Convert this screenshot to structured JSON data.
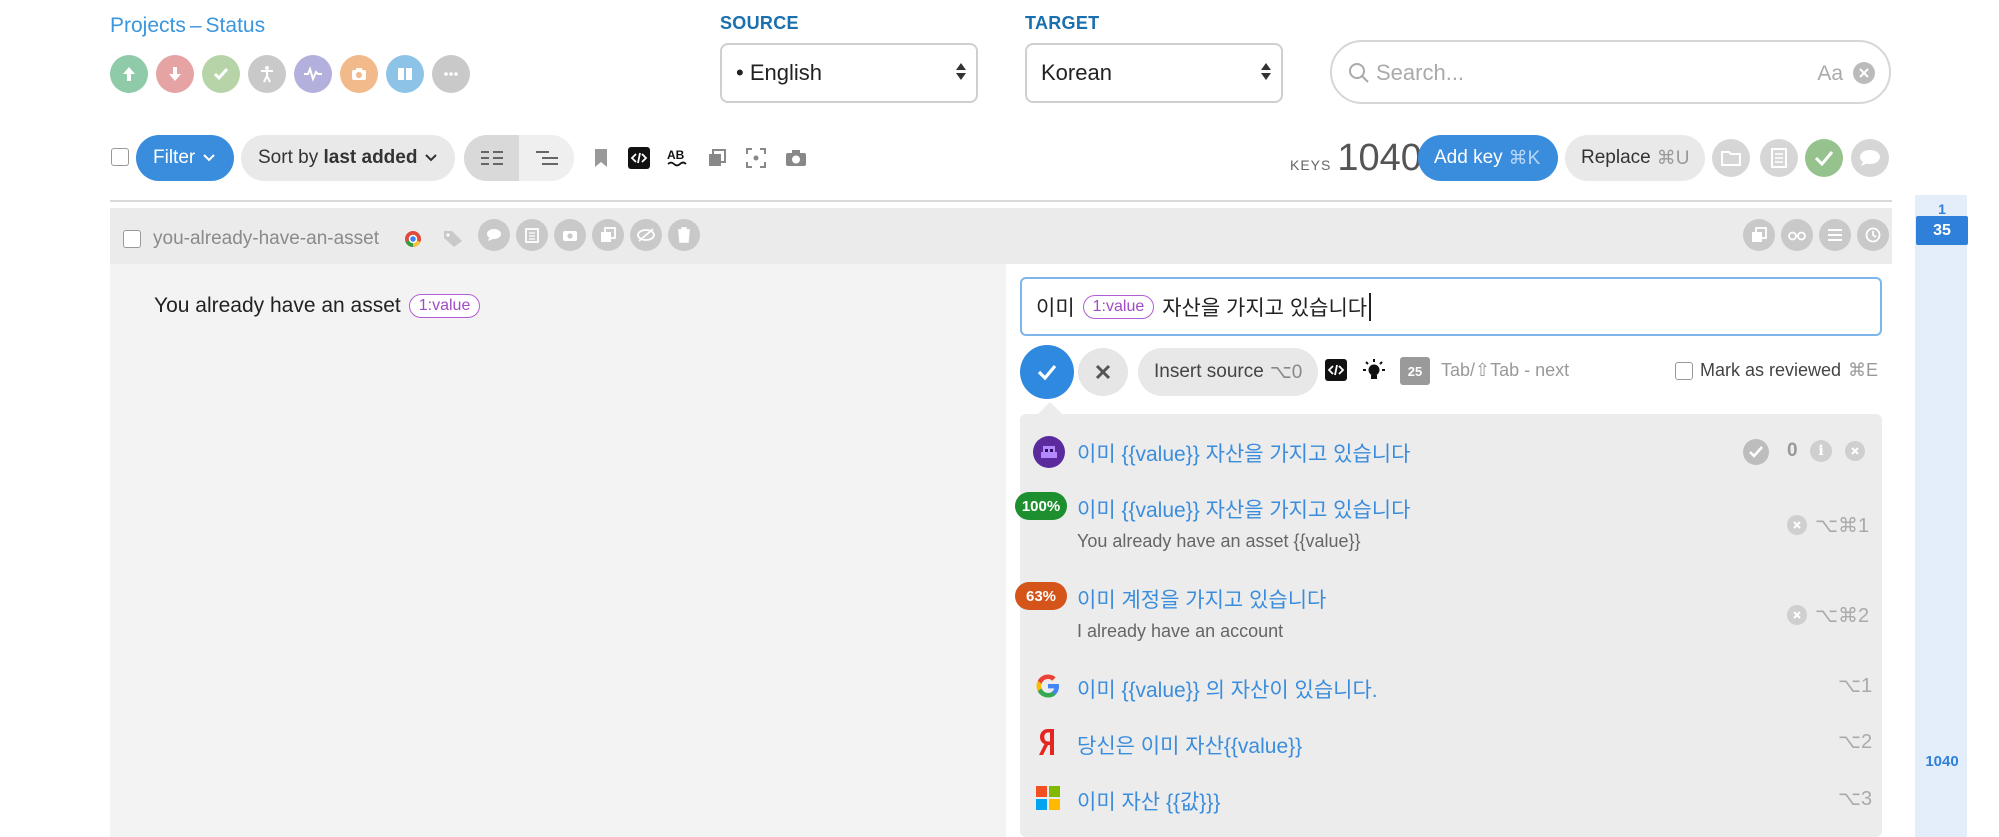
{
  "header": {
    "breadcrumb_projects": "Projects",
    "breadcrumb_separator": "–",
    "breadcrumb_status": "Status",
    "status_icons": [
      {
        "name": "upload-icon",
        "color": "#8fcba9"
      },
      {
        "name": "download-icon",
        "color": "#e6a3a3"
      },
      {
        "name": "check-icon",
        "color": "#b6d4a8"
      },
      {
        "name": "accessibility-icon",
        "color": "#c9c9c9"
      },
      {
        "name": "activity-icon",
        "color": "#b3b0de"
      },
      {
        "name": "camera-icon",
        "color": "#f2b98a"
      },
      {
        "name": "book-icon",
        "color": "#8ec3e8"
      },
      {
        "name": "more-icon",
        "color": "#c9c9c9"
      }
    ]
  },
  "source": {
    "label": "SOURCE",
    "value": "• English"
  },
  "target": {
    "label": "TARGET",
    "value": "Korean"
  },
  "search": {
    "placeholder": "Search...",
    "case_toggle": "Aa"
  },
  "toolbar": {
    "filter_label": "Filter",
    "sort_prefix": "Sort by ",
    "sort_value": "last added",
    "keys_label": "KEYS",
    "keys_count": "1040",
    "add_key_label": "Add key",
    "add_key_shortcut": "⌘K",
    "replace_label": "Replace",
    "replace_shortcut": "⌘U"
  },
  "key": {
    "name": "you-already-have-an-asset",
    "source_text": "You already have an asset",
    "placeholder_tag": "1:value",
    "translation_before": "이미",
    "translation_after": "자산을 가지고 있습니다"
  },
  "editor_actions": {
    "insert_source_label": "Insert source",
    "insert_source_shortcut": "⌥0",
    "char_count": "25",
    "next_hint": "Tab/⇧Tab - next",
    "mark_reviewed_label": "Mark as reviewed",
    "mark_reviewed_shortcut": "⌘E"
  },
  "suggestions": [
    {
      "text": "이미 {{value}} 자산을 가지고 있습니다",
      "count": "0",
      "source": "avatar"
    },
    {
      "text": "이미 {{value}} 자산을 가지고 있습니다",
      "sub": "You already have an asset {{value}}",
      "match": "100%",
      "match_color": "#1e8f2e",
      "shortcut": "⌥⌘1"
    },
    {
      "text": "이미 계정을 가지고 있습니다",
      "sub": "I already have an account",
      "match": "63%",
      "match_color": "#d4541a",
      "shortcut": "⌥⌘2"
    },
    {
      "text": "이미 {{value}} 의 자산이 있습니다.",
      "source": "google",
      "shortcut": "⌥1"
    },
    {
      "text": "당신은 이미 자산{{value}}",
      "source": "yandex",
      "shortcut": "⌥2"
    },
    {
      "text": "이미 자산 {{값}}}",
      "source": "microsoft",
      "shortcut": "⌥3"
    }
  ],
  "rail": {
    "top": "1",
    "current": "35",
    "bottom": "1040"
  }
}
